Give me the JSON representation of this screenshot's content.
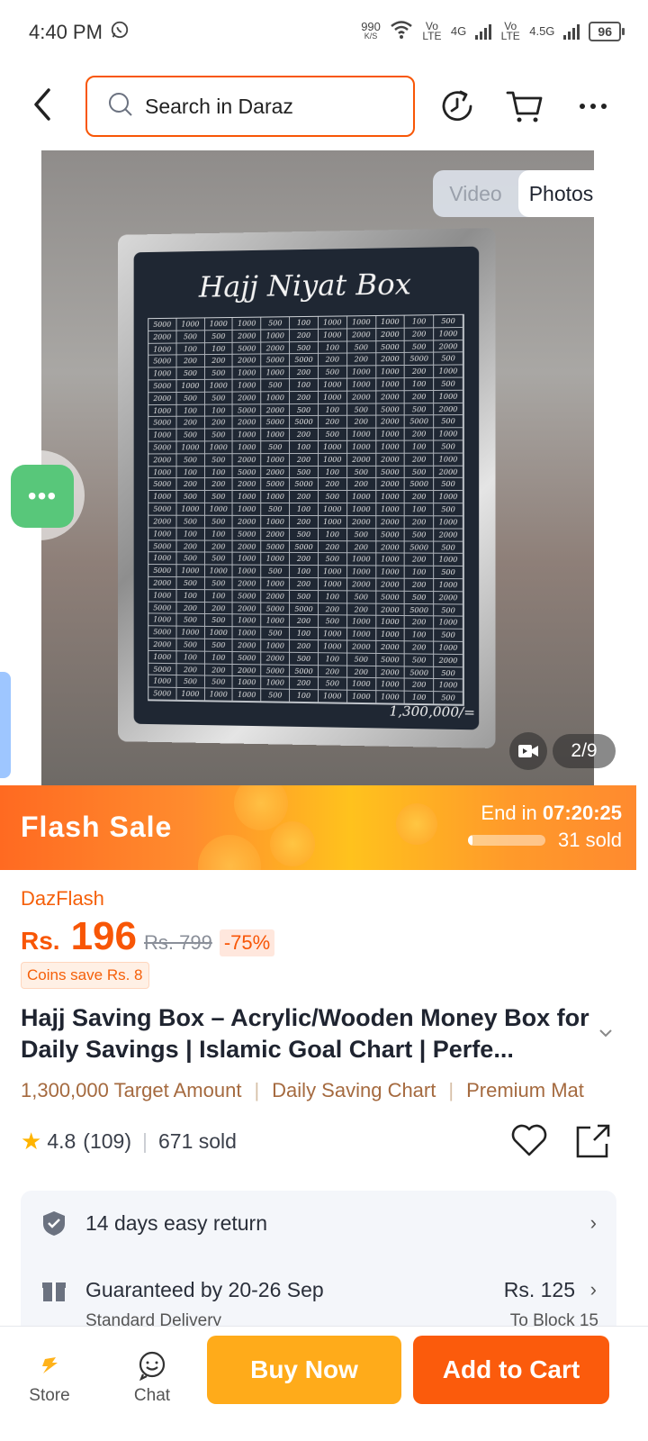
{
  "status_bar": {
    "time": "4:40 PM",
    "net_speed_value": "990",
    "net_speed_unit": "K/S",
    "sim1_label": "Vo LTE",
    "sim1_net": "4G",
    "sim2_label": "Vo LTE",
    "sim2_net": "4.5G",
    "battery": "96",
    "icons": [
      "whatsapp-icon",
      "wifi-icon",
      "signal-icon",
      "battery-icon"
    ]
  },
  "header": {
    "search_placeholder": "Search in Daraz",
    "icons": [
      "back-icon",
      "search-icon",
      "history-icon",
      "cart-icon",
      "more-icon"
    ],
    "accent_color": "#f85606"
  },
  "gallery": {
    "tabs": [
      "Video",
      "Photos"
    ],
    "active_tab": "Photos",
    "counter": "2/9",
    "image": {
      "title": "Hajj Niyat Box",
      "grid_values": [
        "5000",
        "1000",
        "1000",
        "1000",
        "500",
        "100",
        "1000",
        "1000",
        "1000",
        "100",
        "500",
        "2000",
        "500",
        "500",
        "2000",
        "1000",
        "200",
        "1000",
        "2000",
        "2000",
        "200",
        "1000",
        "1000",
        "100",
        "100",
        "5000",
        "2000",
        "500",
        "100",
        "500",
        "5000",
        "500",
        "2000",
        "5000",
        "200",
        "200",
        "2000",
        "5000",
        "5000",
        "200",
        "200",
        "2000",
        "5000",
        "500",
        "1000",
        "500",
        "500",
        "1000",
        "1000",
        "200",
        "500",
        "1000",
        "1000",
        "200",
        "1000"
      ],
      "total": "1,300,000/="
    }
  },
  "flash_sale": {
    "title": "Flash Sale",
    "end_label": "End in",
    "countdown": "07:20:25",
    "sold_label": "31 sold",
    "progress": 0.06
  },
  "product": {
    "badge": "DazFlash",
    "currency": "Rs.",
    "price": "196",
    "old_price": "Rs. 799",
    "discount": "-75%",
    "coins_save": "Coins save Rs. 8",
    "title": "Hajj Saving Box  – Acrylic/Wooden Money Box for Daily Savings | Islamic Goal Chart | Perfe...",
    "features": [
      "1,300,000 Target Amount",
      "Daily Saving Chart",
      "Premium Mat"
    ],
    "rating": "4.8",
    "reviews": "(109)",
    "sold": "671 sold"
  },
  "services": {
    "return": "14 days easy return",
    "delivery": "Guaranteed by 20-26 Sep",
    "delivery_price": "Rs. 125",
    "delivery_type": "Standard Delivery",
    "delivery_to": "To Block 15"
  },
  "bottom_bar": {
    "store_label": "Store",
    "chat_label": "Chat",
    "buy_now": "Buy Now",
    "add_to_cart": "Add to Cart",
    "buy_color": "#ffab1a",
    "cart_color": "#fb5b0c"
  }
}
